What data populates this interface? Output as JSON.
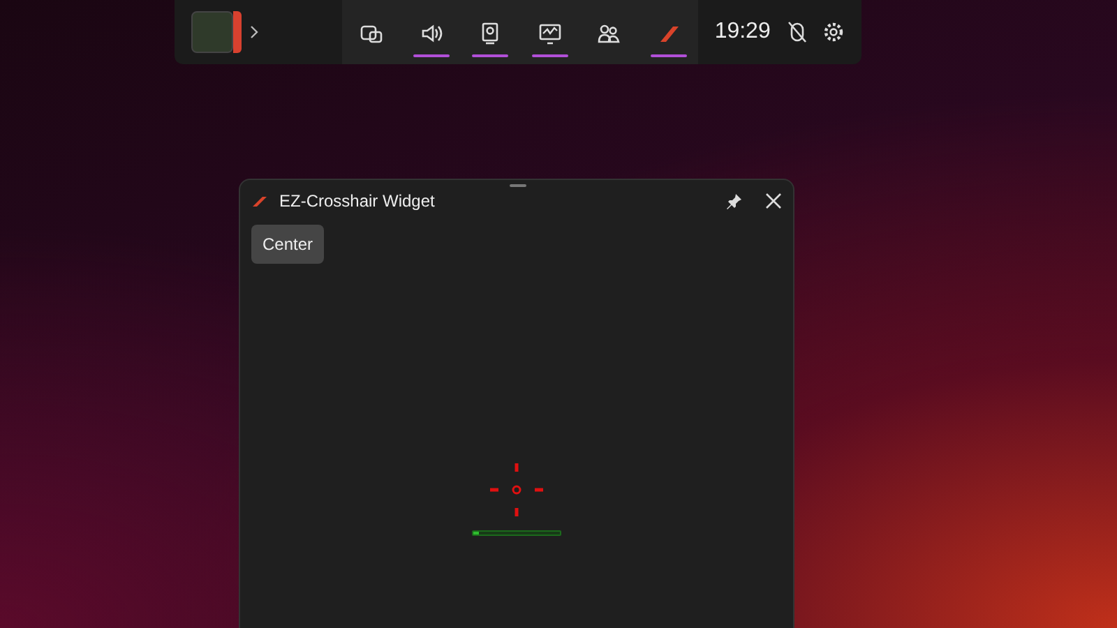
{
  "game_bar": {
    "widgets": [
      {
        "kind": "capture",
        "pinned": false
      },
      {
        "kind": "audio",
        "pinned": true
      },
      {
        "kind": "webcam",
        "pinned": true
      },
      {
        "kind": "performance",
        "pinned": true
      },
      {
        "kind": "social",
        "pinned": false
      },
      {
        "kind": "crosshair",
        "pinned": true
      }
    ],
    "time": "19:29"
  },
  "widget": {
    "title": "EZ-Crosshair Widget",
    "buttons": [
      "Center"
    ],
    "bar": {
      "level": 0.06
    }
  }
}
